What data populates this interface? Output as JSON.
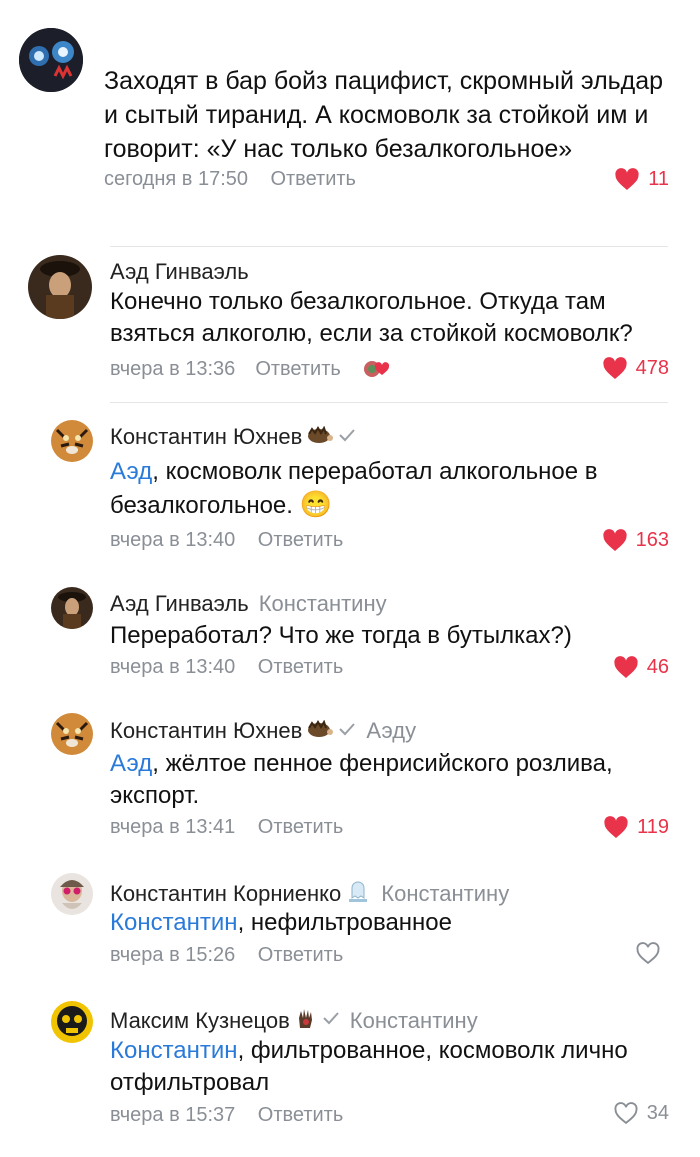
{
  "comments": [
    {
      "author": "",
      "text": "Заходят в бар бойз пацифист, скромный эльдар и сытый тиранид. А космоволк за стойкой им и говорит: «У нас только безалкогольное»",
      "time": "сегодня в 17:50",
      "reply_label": "Ответить",
      "likes": "11"
    },
    {
      "author": "Аэд Гинваэль",
      "text": "Конечно только безалкогольное. Откуда там взяться алкоголю, если за стойкой космоволк?",
      "time": "вчера в 13:36",
      "reply_label": "Ответить",
      "likes": "478"
    },
    {
      "author": "Константин Юхнев",
      "mention": "Аэд",
      "text": ", космоволк переработал алкогольное в безалкогольное.",
      "emoji": "😁",
      "time": "вчера в 13:40",
      "reply_label": "Ответить",
      "likes": "163"
    },
    {
      "author": "Аэд Гинваэль",
      "reply_to": "Константину",
      "text": "Переработал? Что же тогда в бутылках?)",
      "time": "вчера в 13:40",
      "reply_label": "Ответить",
      "likes": "46"
    },
    {
      "author": "Константин Юхнев",
      "reply_to": "Аэду",
      "mention": "Аэд",
      "text": ", жёлтое пенное фенрисийского розлива, экспорт.",
      "time": "вчера в 13:41",
      "reply_label": "Ответить",
      "likes": "119"
    },
    {
      "author": "Константин Корниенко",
      "reply_to": "Константину",
      "mention": "Константин",
      "text": ", нефильтрованное",
      "time": "вчера в 15:26",
      "reply_label": "Ответить",
      "likes": ""
    },
    {
      "author": "Максим Кузнецов",
      "reply_to": "Константину",
      "mention": "Константин",
      "text": ", фильтрованное, космоволк лично отфильтровал",
      "time": "вчера в 15:37",
      "reply_label": "Ответить",
      "likes": "34"
    }
  ],
  "colors": {
    "like_red": "#e8334a",
    "mention_blue": "#2a7ad9",
    "muted": "#8a8f96"
  },
  "icons": [
    "heart-filled-icon",
    "heart-outline-icon",
    "verified-check-icon",
    "reaction-icon"
  ]
}
